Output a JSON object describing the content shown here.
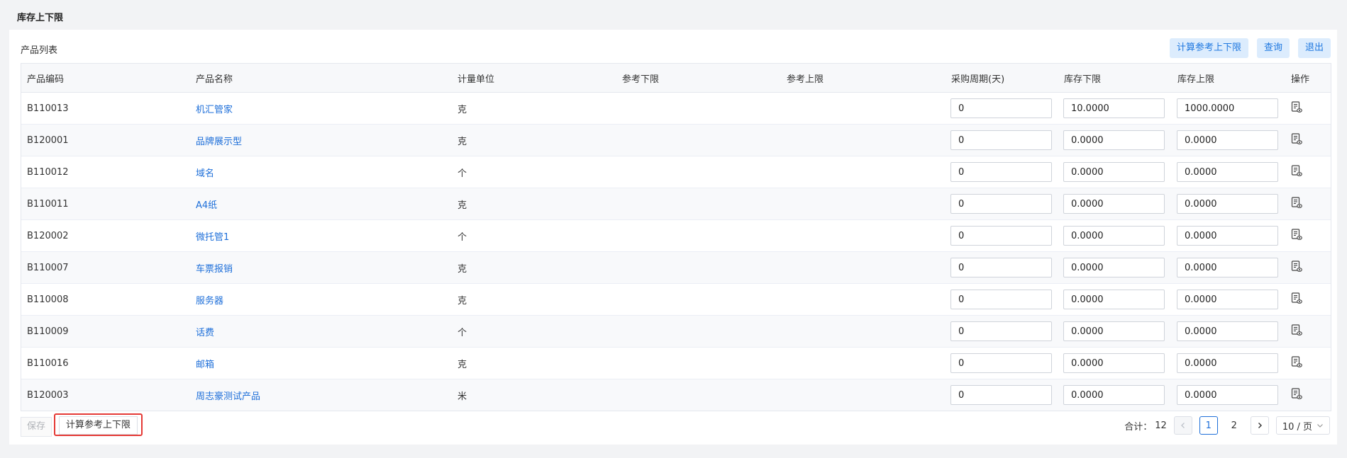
{
  "page": {
    "title": "库存上下限"
  },
  "panel": {
    "title": "产品列表"
  },
  "toolbar": {
    "calc_label": "计算参考上下限",
    "query_label": "查询",
    "exit_label": "退出"
  },
  "table": {
    "headers": [
      "产品编码",
      "产品名称",
      "计量单位",
      "参考下限",
      "参考上限",
      "采购周期(天)",
      "库存下限",
      "库存上限",
      "操作"
    ],
    "rows": [
      {
        "code": "B110013",
        "name": "机汇管家",
        "unit": "克",
        "ref_low": "",
        "ref_high": "",
        "cycle": "0",
        "stock_low": "10.0000",
        "stock_high": "1000.0000"
      },
      {
        "code": "B120001",
        "name": "品牌展示型",
        "unit": "克",
        "ref_low": "",
        "ref_high": "",
        "cycle": "0",
        "stock_low": "0.0000",
        "stock_high": "0.0000"
      },
      {
        "code": "B110012",
        "name": "域名",
        "unit": "个",
        "ref_low": "",
        "ref_high": "",
        "cycle": "0",
        "stock_low": "0.0000",
        "stock_high": "0.0000"
      },
      {
        "code": "B110011",
        "name": "A4纸",
        "unit": "克",
        "ref_low": "",
        "ref_high": "",
        "cycle": "0",
        "stock_low": "0.0000",
        "stock_high": "0.0000"
      },
      {
        "code": "B120002",
        "name": "微托管1",
        "unit": "个",
        "ref_low": "",
        "ref_high": "",
        "cycle": "0",
        "stock_low": "0.0000",
        "stock_high": "0.0000"
      },
      {
        "code": "B110007",
        "name": "车票报销",
        "unit": "克",
        "ref_low": "",
        "ref_high": "",
        "cycle": "0",
        "stock_low": "0.0000",
        "stock_high": "0.0000"
      },
      {
        "code": "B110008",
        "name": "服务器",
        "unit": "克",
        "ref_low": "",
        "ref_high": "",
        "cycle": "0",
        "stock_low": "0.0000",
        "stock_high": "0.0000"
      },
      {
        "code": "B110009",
        "name": "话费",
        "unit": "个",
        "ref_low": "",
        "ref_high": "",
        "cycle": "0",
        "stock_low": "0.0000",
        "stock_high": "0.0000"
      },
      {
        "code": "B110016",
        "name": "邮箱",
        "unit": "克",
        "ref_low": "",
        "ref_high": "",
        "cycle": "0",
        "stock_low": "0.0000",
        "stock_high": "0.0000"
      },
      {
        "code": "B120003",
        "name": "周志豪测试产品",
        "unit": "米",
        "ref_low": "",
        "ref_high": "",
        "cycle": "0",
        "stock_low": "0.0000",
        "stock_high": "0.0000"
      }
    ],
    "row_action_icon": "view-document-icon"
  },
  "footer": {
    "save_label": "保存",
    "calc_label": "计算参考上下限",
    "total_label": "合计：",
    "total": "12",
    "prev_icon": "chevron-left-icon",
    "next_icon": "chevron-right-icon",
    "pages": [
      "1",
      "2"
    ],
    "current_page": "1",
    "page_size_label": "10 / 页",
    "page_size_icon": "chevron-down-icon"
  },
  "colors": {
    "link": "#1e6fd9",
    "toolbar_button_bg": "#dcecfd",
    "highlight_border": "#e53935"
  }
}
